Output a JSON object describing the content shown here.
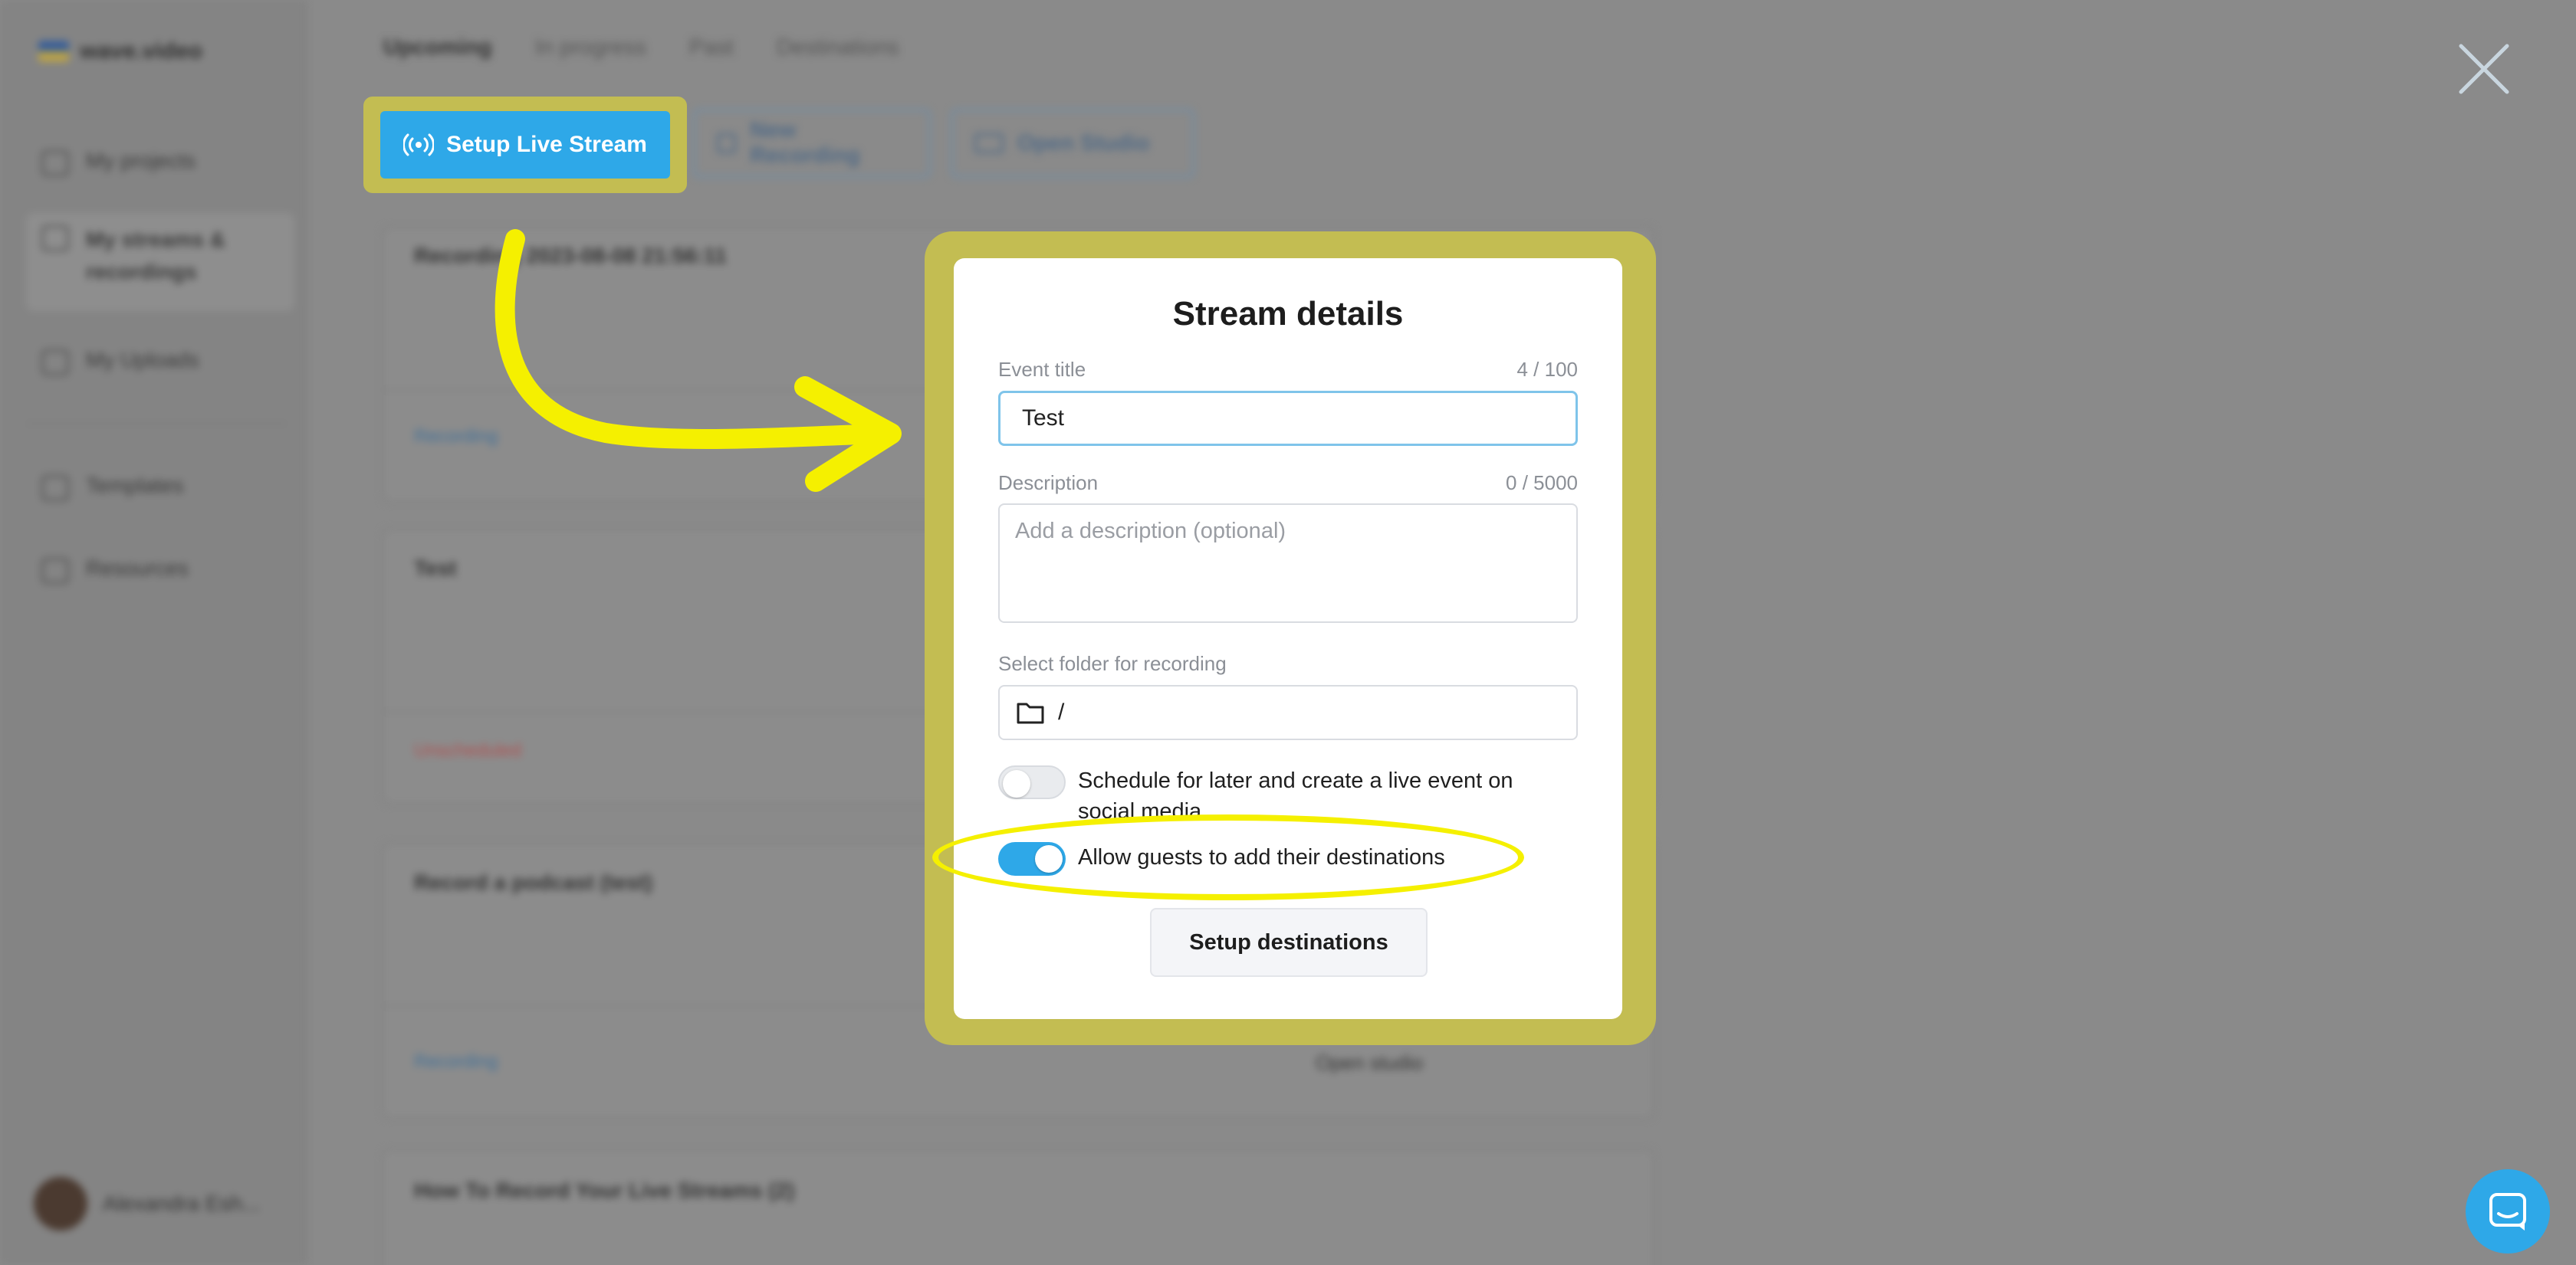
{
  "background": {
    "brand": "wave.video",
    "sidebar": {
      "items": [
        {
          "label": "My projects",
          "icon": "projects-icon"
        },
        {
          "label": "My streams & recordings",
          "icon": "streams-icon",
          "active": true
        },
        {
          "label": "My Uploads",
          "icon": "uploads-icon"
        },
        {
          "label": "Templates",
          "icon": "templates-icon"
        },
        {
          "label": "Resources",
          "icon": "resources-icon"
        }
      ],
      "user_name": "Alexandra Esh..."
    },
    "tabs": [
      "Upcoming",
      "In progress",
      "Past",
      "Destinations"
    ],
    "toolbar": {
      "new_recording": "New Recording",
      "open_studio": "Open Studio"
    },
    "cards": [
      {
        "title": "Recording 2023-08-08 21:56:11",
        "tag": "Recording"
      },
      {
        "title": "Test",
        "tag": "Unscheduled"
      },
      {
        "title": "Record a podcast (test)",
        "tag": "Recording",
        "action": "Open studio"
      },
      {
        "title": "How To Record Your Live Streams (2)"
      }
    ]
  },
  "highlight_button": {
    "label": "Setup Live Stream",
    "icon": "broadcast-icon"
  },
  "modal": {
    "title": "Stream details",
    "event_title": {
      "label": "Event title",
      "count": "4 / 100",
      "value": "Test"
    },
    "description": {
      "label": "Description",
      "count": "0 / 5000",
      "placeholder": "Add a description (optional)",
      "value": ""
    },
    "folder": {
      "label": "Select folder for recording",
      "value": "/",
      "icon": "folder-icon"
    },
    "schedule_toggle": {
      "label": "Schedule for later and create a live event on social media",
      "on": false
    },
    "guests_toggle": {
      "label": "Allow guests to add their destinations",
      "on": true
    },
    "setup_destinations": "Setup destinations"
  },
  "colors": {
    "accent": "#2ea8e8",
    "highlight": "#c3bd52",
    "annotation_yellow": "#f5f000",
    "overlay": "#8a8a8a"
  }
}
